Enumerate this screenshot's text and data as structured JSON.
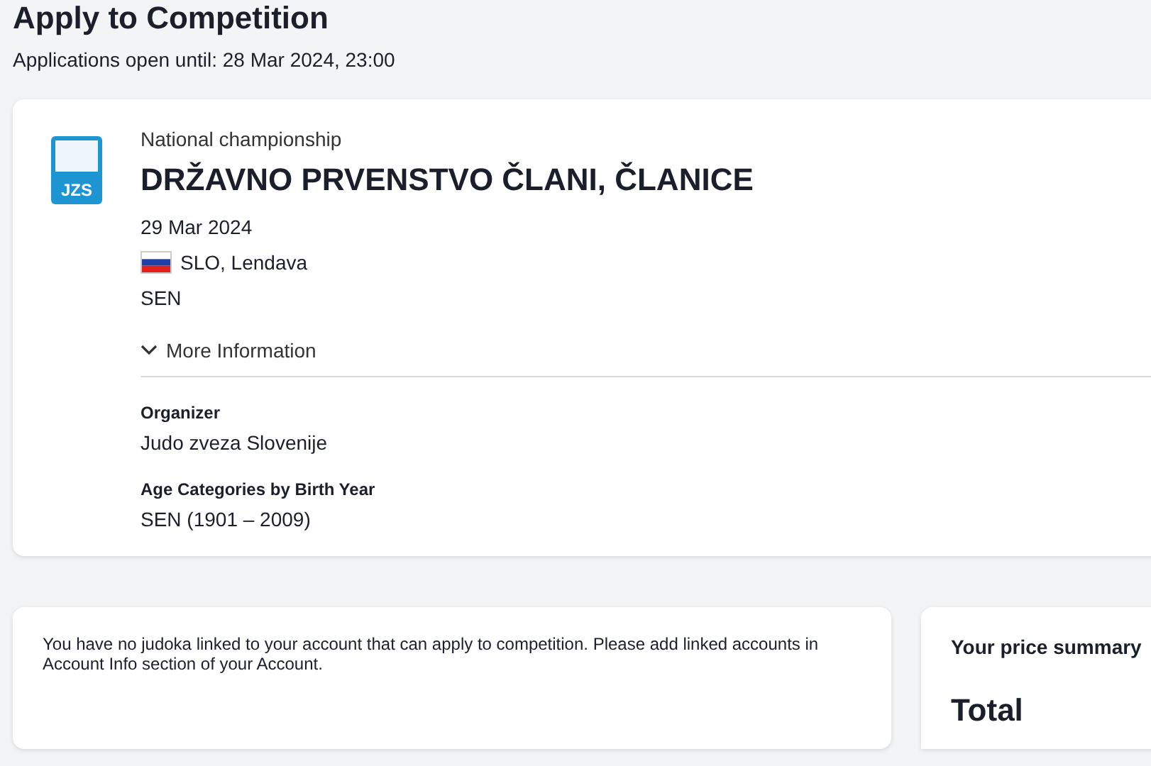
{
  "page": {
    "title": "Apply to Competition",
    "deadline": "Applications open until: 28 Mar 2024, 23:00"
  },
  "competition": {
    "type": "National championship",
    "name": "DRŽAVNO PRVENSTVO ČLANI, ČLANICE",
    "date": "29 Mar 2024",
    "location": "SLO, Lendava",
    "category": "SEN",
    "logo_text": "JZS",
    "more_info": {
      "label": "More Information",
      "expanded": true
    },
    "details": [
      {
        "label": "Organizer",
        "value": "Judo zveza Slovenije"
      },
      {
        "label": "Age Categories by Birth Year",
        "value": "SEN (1901 – 2009)"
      }
    ]
  },
  "notice": "You have no judoka linked to your account that can apply to competition. Please add linked accounts in Account Info section of your Account.",
  "price_summary": {
    "title": "Your price summary",
    "total_label": "Total"
  }
}
